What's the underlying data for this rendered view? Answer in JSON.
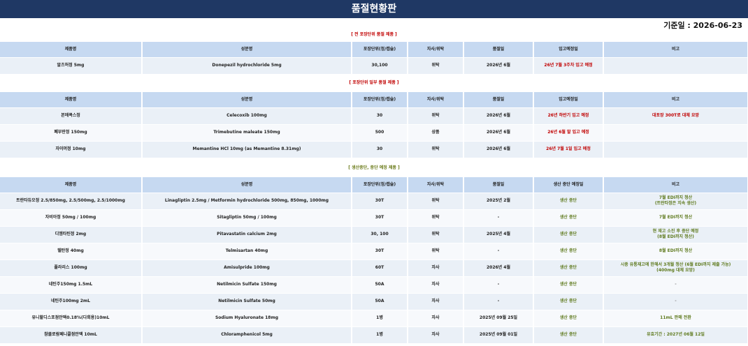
{
  "page": {
    "title": "품절현황판",
    "base_date": "기준일 : 2026-06-23"
  },
  "sections": [
    {
      "title": "[ 전 포장단위 품절 제품 ]",
      "headers": [
        "제품명",
        "성분명",
        "포장단위(정/캡슐)",
        "자사/위탁",
        "품절일",
        "입고예정일",
        "비고"
      ],
      "rows": [
        [
          "알츠허정 5mg",
          "Donepezil hydrochloride 5mg",
          "30,100",
          "위탁",
          "2026년 6월",
          "26년 7월 3주차 입고 예정",
          ""
        ]
      ]
    },
    {
      "title": "[ 포장단위 일부 품절 제품 ]",
      "headers": [
        "제품명",
        "성분명",
        "포장단위(정/캡슐)",
        "자사/위탁",
        "품절일",
        "입고예정일",
        "비고"
      ],
      "rows": [
        [
          "본에콕스정",
          "Celecoxib 100mg",
          "30",
          "위탁",
          "2026년 6월",
          "26년 하반기 입고 예정",
          "대포장 300T로 대체 요망"
        ],
        [
          "폐부란정 150mg",
          "Trimebutine maleate 150mg",
          "500",
          "상품",
          "2026년 6월",
          "26년 6월 말 입고 예정",
          ""
        ],
        [
          "자이머정 10mg",
          "Memantine HCl 10mg (as Memantine 8.31mg)",
          "30",
          "위탁",
          "2026년 6월",
          "26년 7월 1일 입고 예정",
          ""
        ]
      ]
    },
    {
      "title": "[ 생산중단, 중단 예정 제품 ]",
      "headers": [
        "제품명",
        "성분명",
        "포장단위(정/캡슐)",
        "자사/위탁",
        "품절일",
        "생산 중단 예정일",
        "비고"
      ],
      "rows": [
        [
          "트란타듀오정 2.5/850mg, 2.5/500mg, 2.5/1000mg",
          "Linagliptin 2.5mg / Metformin hydrochloride 500mg, 850mg, 1000mg",
          "30T",
          "위탁",
          "2025년 2월",
          "생산 중단",
          "7월 EDI까지 청산\n(트란타정은 지속 생산)"
        ],
        [
          "자비아정 50mg / 100mg",
          "Sitagliptin 50mg / 100mg",
          "30T",
          "위탁",
          "-",
          "생산 중단",
          "7월 EDI까지 청산"
        ],
        [
          "디엠타틴정 2mg",
          "Pitavastatin calcium 2mg",
          "30, 100",
          "위탁",
          "2025년 4월",
          "생산 중단",
          "현 재고 소진 후 중단 예정\n(8월 EDI까지 청산)"
        ],
        [
          "텔탄정 40mg",
          "Telmisartan 40mg",
          "30T",
          "위탁",
          "-",
          "생산 중단",
          "8월 EDI까지 청산"
        ],
        [
          "폴라리스 100mg",
          "Amisulpride 100mg",
          "60T",
          "자사",
          "2026년 4월",
          "생산 중단",
          "시중 유통재고에 한해서 3개월 청산 (6월 EDI까지 제출 가능)\n(400mg 대체 요망)"
        ],
        [
          "네틴주150mg 1.5mL",
          "Netilmicin Sulfate 150mg",
          "50A",
          "자사",
          "-",
          "생산 중단",
          "-"
        ],
        [
          "네틴주100mg 2mL",
          "Netilmicin Sulfate 50mg",
          "50A",
          "자사",
          "-",
          "생산 중단",
          "-"
        ],
        [
          "유니할디스포점안액0.18%(다회용)10mL",
          "Sodium Hyaluronate 18mg",
          "1병",
          "자사",
          "2025년 09월 25일",
          "생산 중단",
          "11mL 판매 전환"
        ],
        [
          "참클로람페니콜점안액 10mL",
          "Chloramphenicol 5mg",
          "1병",
          "자사",
          "2025년 09월 01일",
          "생산 중단",
          "유효기간 : 2027년 06월 12일"
        ]
      ]
    }
  ],
  "colors": {
    "title_bg": "#1f3864",
    "header_bg": "#c6d9f1",
    "row_bg": "#eaf0f7",
    "red_text": "#c00000",
    "green_text": "#5f7a1e"
  }
}
